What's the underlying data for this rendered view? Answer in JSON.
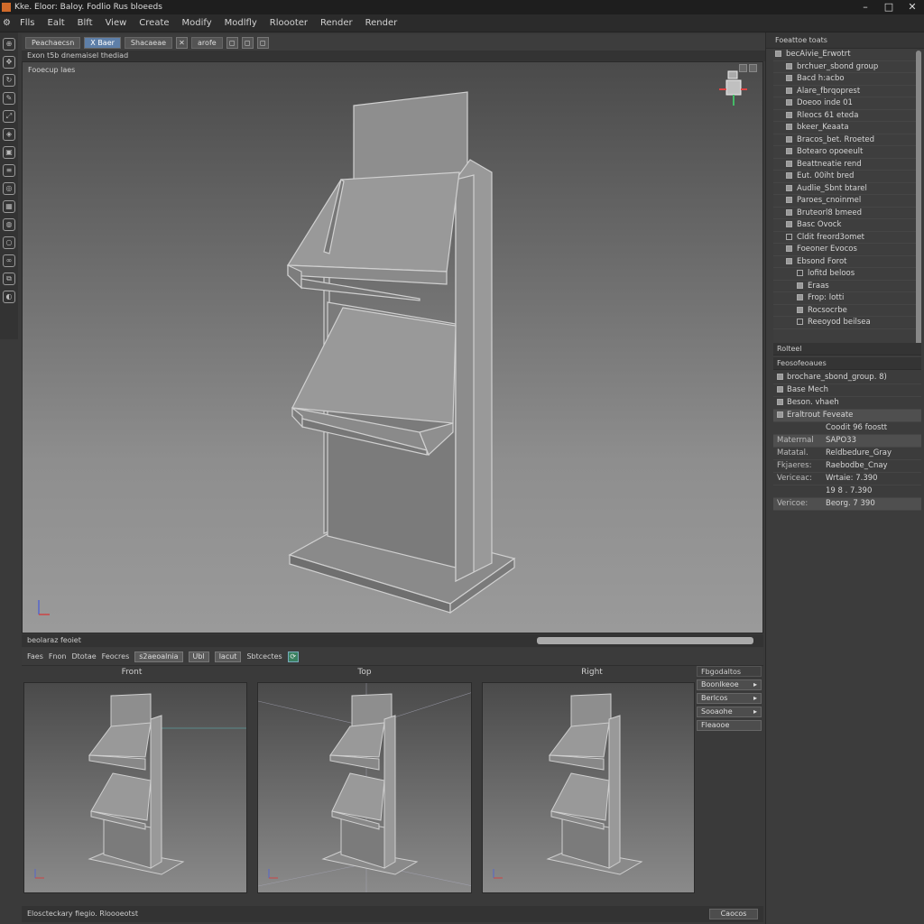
{
  "titlebar": {
    "title": "Kke. Eloor: Baloy. Fodlio Rus bloeeds",
    "minimize": "–",
    "maximize": "□",
    "close": "✕"
  },
  "menu": [
    "Flls",
    "Ealt",
    "Blft",
    "View",
    "Create",
    "Modify",
    "Modlfly",
    "Rloooter",
    "Render",
    "Render"
  ],
  "viewport_toolbar": {
    "btn1": "Peachaecsn",
    "btn2": "X Baer",
    "btn3": "Shacaeae",
    "field": "arofe",
    "icons": [
      "✕",
      "◻",
      "◻",
      "◻"
    ]
  },
  "viewport_info": "Exon t5b dnemaisel thediad",
  "viewport_label": "Fooecup laes",
  "mid_status": "beolaraz feoiet",
  "subtoolbar": {
    "items": [
      "Faes",
      "Fnon",
      "Dtotae",
      "Feocres"
    ],
    "field1": "s2aeoalnia",
    "field2": "Ubl",
    "field3": "lacut",
    "label": "Sbtcectes",
    "icon": "⟳"
  },
  "ortho": {
    "front": "Front",
    "top": "Top",
    "right": "Right"
  },
  "side_mini": {
    "head": "Fbgodaltos",
    "items": [
      "Boonlkeoe",
      "Berlcos",
      "Sooaohe",
      "Fleaooe"
    ]
  },
  "bottom_status": "Eloscteckary fiegio. Rloooeotst",
  "bottom_btn": "Caocos",
  "outliner": {
    "head": "Foeattoe toats",
    "rows": [
      {
        "label": "becAivie_Erwotrt",
        "filled": true
      },
      {
        "label": "brchuer_sbond group",
        "filled": true
      },
      {
        "label": "Bacd h:acbo",
        "filled": true
      },
      {
        "label": "Alare_fbrqoprest",
        "filled": true
      },
      {
        "label": "Doeoo inde 01",
        "filled": true
      },
      {
        "label": "Rleocs 61 eteda",
        "filled": true
      },
      {
        "label": "bkeer_Keaata",
        "filled": true
      },
      {
        "label": "Bracos_bet. Rroeted",
        "filled": true
      },
      {
        "label": "Botearo opoeeult",
        "filled": true
      },
      {
        "label": "Beattneatie rend",
        "filled": true
      },
      {
        "label": "Eut. 00iht bred",
        "filled": true
      },
      {
        "label": "Audlie_Sbnt btarel",
        "filled": true
      },
      {
        "label": "Paroes_cnoinmel",
        "filled": true
      },
      {
        "label": "Bruteorl8 bmeed",
        "filled": true
      },
      {
        "label": "Basc Ovock",
        "filled": true
      },
      {
        "label": "Cldit freord3omet",
        "filled": false
      },
      {
        "label": "Foeoner Evocos",
        "filled": true
      },
      {
        "label": "Ebsond Forot",
        "filled": true
      },
      {
        "label": "lofitd beloos",
        "filled": false
      },
      {
        "label": "Eraas",
        "filled": true
      },
      {
        "label": "Frop: lotti",
        "filled": true
      },
      {
        "label": "Rocsocrbe",
        "filled": true
      },
      {
        "label": "Reeoyod beilsea",
        "filled": false
      }
    ]
  },
  "rp_section1": "Rolteel",
  "props": {
    "head": "Feosofeoaues",
    "rows": [
      {
        "k": "",
        "v": "brochare_sbond_group. 8)",
        "sq": true,
        "hl": false
      },
      {
        "k": "",
        "v": "Base Mech",
        "sq": true,
        "hl": false
      },
      {
        "k": "",
        "v": "Beson. vhaeh",
        "sq": true,
        "hl": false
      },
      {
        "k": "",
        "v": "Eraltrout Feveate",
        "sq": true,
        "hl": true
      },
      {
        "k": "",
        "v": "Coodit 96 foostt",
        "sq": false,
        "hl": false
      },
      {
        "k": "Materrnal",
        "v": "SAPO33",
        "sq": false,
        "hl": true
      },
      {
        "k": "Matatal.",
        "v": "Reldbedure_Gray",
        "sq": false,
        "hl": false
      },
      {
        "k": "Fkjaeres:",
        "v": "Raebodbe_Cnay",
        "sq": false,
        "hl": false
      },
      {
        "k": "Vericeac:",
        "v": "Wrtaie: 7.390",
        "sq": false,
        "hl": false
      },
      {
        "k": "",
        "v": "19 8 . 7.390",
        "sq": false,
        "hl": false
      },
      {
        "k": "Vericoe:",
        "v": "Beorg. 7 390",
        "sq": false,
        "hl": true
      }
    ]
  },
  "colors": {
    "accent": "#5e7fa8",
    "viewport_top": "#4a4a4a",
    "viewport_bottom": "#9a9a9a"
  }
}
